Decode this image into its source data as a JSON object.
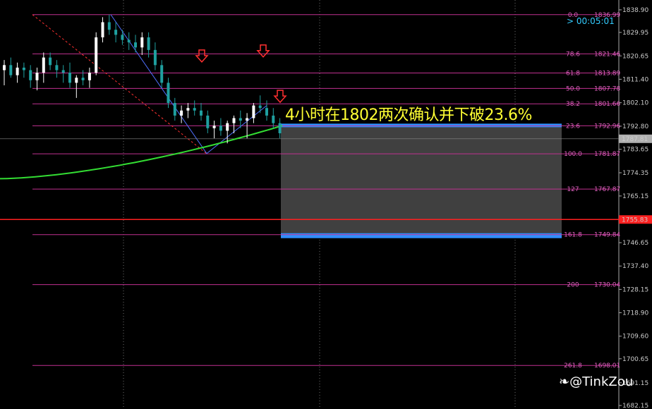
{
  "chart_data": {
    "type": "candlestick",
    "price_axis": {
      "ticks": [
        1838.9,
        1829.95,
        1820.65,
        1811.4,
        1802.1,
        1792.8,
        1783.65,
        1774.35,
        1765.15,
        1755.85,
        1746.65,
        1737.4,
        1728.15,
        1718.9,
        1709.6,
        1700.65,
        1691.15,
        1682.15
      ],
      "ylim": [
        1682.15,
        1840.0
      ]
    },
    "current_price": "1787.81",
    "horizontal_line_price": "1755.83",
    "fib_levels": [
      {
        "ratio": "0.0",
        "price": "1836.99"
      },
      {
        "ratio": "78.6",
        "price": "1821.46"
      },
      {
        "ratio": "61.8",
        "price": "1813.89"
      },
      {
        "ratio": "50.0",
        "price": "1807.78"
      },
      {
        "ratio": "38.2",
        "price": "1801.66"
      },
      {
        "ratio": "23.6",
        "price": "1792.96"
      },
      {
        "ratio": "100.0",
        "price": "1781.87"
      },
      {
        "ratio": "127",
        "price": "1767.87"
      },
      {
        "ratio": "161.8",
        "price": "1749.84"
      },
      {
        "ratio": "200",
        "price": "1730.04"
      },
      {
        "ratio": "261.8",
        "price": "1698.01"
      }
    ],
    "candles": [
      [
        1815,
        1819,
        1809,
        1817
      ],
      [
        1817,
        1820,
        1812,
        1813
      ],
      [
        1813,
        1818,
        1810,
        1816
      ],
      [
        1816,
        1818,
        1812,
        1815
      ],
      [
        1815,
        1817,
        1808,
        1811
      ],
      [
        1811,
        1816,
        1807,
        1814
      ],
      [
        1814,
        1822,
        1810,
        1820
      ],
      [
        1820,
        1822,
        1815,
        1817
      ],
      [
        1817,
        1819,
        1812,
        1815
      ],
      [
        1815,
        1817,
        1810,
        1814
      ],
      [
        1814,
        1818,
        1808,
        1810
      ],
      [
        1810,
        1813,
        1804,
        1812
      ],
      [
        1812,
        1815,
        1809,
        1811
      ],
      [
        1811,
        1816,
        1808,
        1814
      ],
      [
        1814,
        1830,
        1813,
        1828
      ],
      [
        1828,
        1836,
        1826,
        1834
      ],
      [
        1834,
        1837,
        1829,
        1831
      ],
      [
        1831,
        1834,
        1826,
        1829
      ],
      [
        1829,
        1831,
        1825,
        1827
      ],
      [
        1827,
        1830,
        1823,
        1826
      ],
      [
        1826,
        1829,
        1822,
        1824
      ],
      [
        1824,
        1830,
        1821,
        1828
      ],
      [
        1828,
        1830,
        1820,
        1823
      ],
      [
        1823,
        1826,
        1815,
        1817
      ],
      [
        1817,
        1819,
        1808,
        1810
      ],
      [
        1810,
        1812,
        1800,
        1802
      ],
      [
        1802,
        1804,
        1795,
        1797
      ],
      [
        1797,
        1801,
        1794,
        1799
      ],
      [
        1799,
        1802,
        1796,
        1800
      ],
      [
        1800,
        1803,
        1797,
        1799
      ],
      [
        1799,
        1802,
        1795,
        1797
      ],
      [
        1797,
        1799,
        1790,
        1792
      ],
      [
        1792,
        1795,
        1788,
        1793
      ],
      [
        1793,
        1796,
        1789,
        1791
      ],
      [
        1791,
        1795,
        1786,
        1794
      ],
      [
        1794,
        1797,
        1790,
        1796
      ],
      [
        1796,
        1799,
        1792,
        1795
      ],
      [
        1795,
        1798,
        1788,
        1796
      ],
      [
        1796,
        1802,
        1794,
        1801
      ],
      [
        1801,
        1805,
        1798,
        1800
      ],
      [
        1800,
        1803,
        1795,
        1797
      ],
      [
        1797,
        1800,
        1792,
        1794
      ],
      [
        1794,
        1796,
        1788,
        1790
      ]
    ]
  },
  "annotation": "4小时在1802两次确认并下破23.6%",
  "timer": "> 00:05:01",
  "watermark": "@TinkZou",
  "colors": {
    "background": "#000000",
    "bull_candle": "#ffffff",
    "bear_candle": "#1fa0a0",
    "fib_line": "#c03090",
    "ma_line": "#33dd33",
    "horizontal_line": "#ff2020",
    "target_box": "#404040",
    "box_edge": "#2f8fff",
    "arrow": "#ff3030",
    "annotation": "#ffff33"
  }
}
